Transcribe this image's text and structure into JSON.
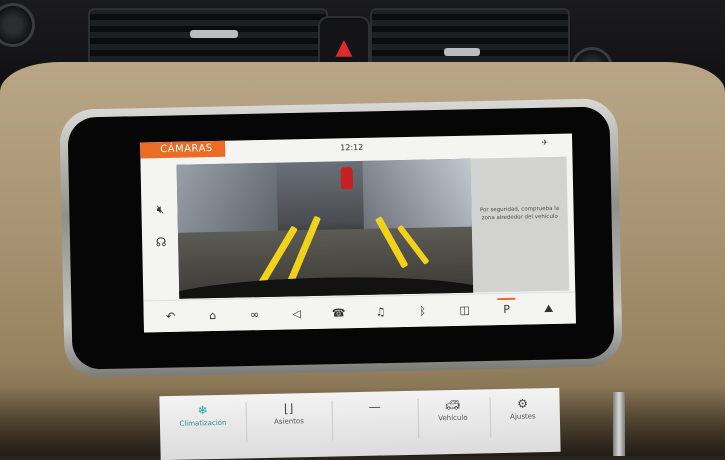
{
  "screen": {
    "title": "CÁMARAS",
    "time": "12:12",
    "info_text": "Por seguridad, comprueba la zona alrededor del vehículo",
    "side_icons": [
      "mute-icon",
      "voice-icon"
    ],
    "bottom_nav": [
      {
        "icon": "back-icon",
        "glyph": "↶"
      },
      {
        "icon": "home-icon",
        "glyph": "⌂"
      },
      {
        "icon": "connect-icon",
        "glyph": "∞"
      },
      {
        "icon": "navigation-icon",
        "glyph": "◁"
      },
      {
        "icon": "phone-icon",
        "glyph": "☎"
      },
      {
        "icon": "media-icon",
        "glyph": "♫"
      },
      {
        "icon": "bluetooth-icon",
        "glyph": "ᛒ"
      },
      {
        "icon": "camera-icon",
        "glyph": "◫"
      },
      {
        "icon": "parking-icon",
        "glyph": "P",
        "label": "P((("
      },
      {
        "icon": "terrain-icon",
        "glyph": "⛰"
      }
    ],
    "accent_color": "#ec6b25"
  },
  "lower_panel": {
    "items": [
      {
        "label": "Climatización",
        "icon": "climate-icon"
      },
      {
        "label": "Asientos",
        "icon": "seat-icon"
      },
      {
        "label": "",
        "icon": "blank-icon"
      },
      {
        "label": "Vehículo",
        "icon": "car-icon"
      },
      {
        "label": "Ajustes",
        "icon": "settings-icon"
      }
    ]
  }
}
